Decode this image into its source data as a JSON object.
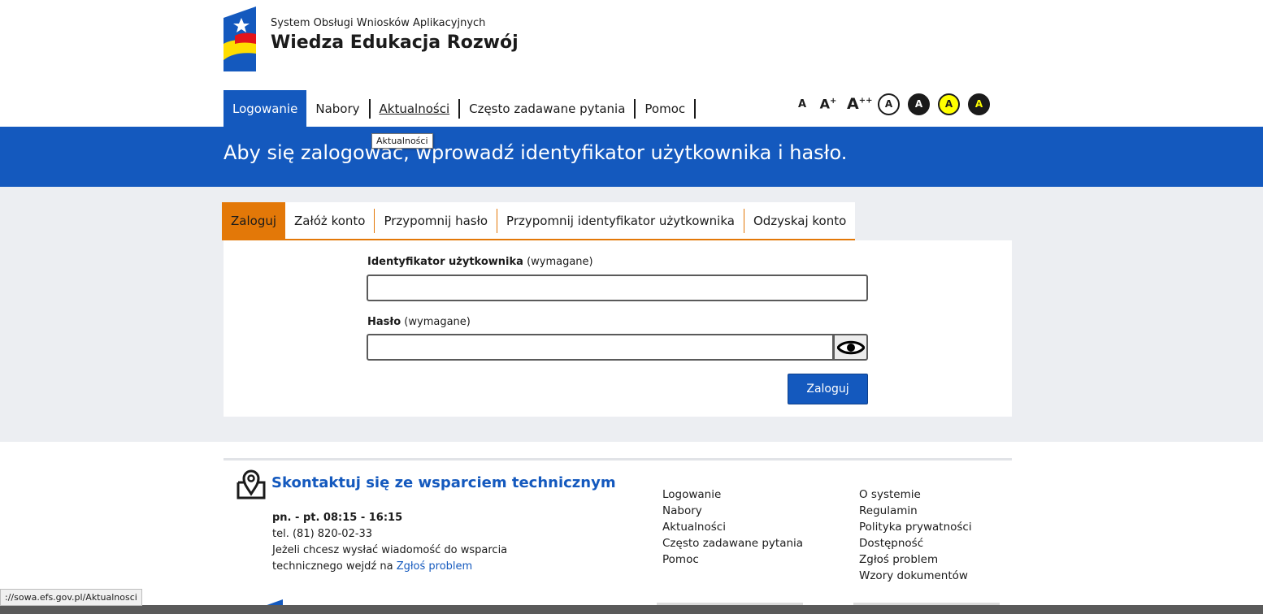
{
  "header": {
    "system_subtitle": "System Obsługi Wniosków Aplikacyjnych",
    "system_title": "Wiedza Edukacja Rozwój"
  },
  "nav": {
    "items": [
      {
        "label": "Logowanie",
        "active": true
      },
      {
        "label": "Nabory"
      },
      {
        "label": "Aktualności",
        "hovered": true
      },
      {
        "label": "Często zadawane pytania"
      },
      {
        "label": "Pomoc"
      }
    ]
  },
  "accessibility": {
    "font_small": "A",
    "font_medium": "A",
    "font_medium_sup": "+",
    "font_large": "A",
    "font_large_sup": "++",
    "contrast_default": "A",
    "contrast_black_white": "A",
    "contrast_yellow_black": "A",
    "contrast_black_yellow": "A"
  },
  "tooltip": "Aktualności",
  "banner": {
    "text": "Aby się zalogować, wprowadź identyfikator użytkownika i hasło."
  },
  "tabs": [
    {
      "label": "Zaloguj",
      "active": true
    },
    {
      "label": "Załóż konto"
    },
    {
      "label": "Przypomnij hasło"
    },
    {
      "label": "Przypomnij identyfikator użytkownika"
    },
    {
      "label": "Odzyskaj konto"
    }
  ],
  "form": {
    "user_id_label": "Identyfikator użytkownika",
    "user_id_required": "(wymagane)",
    "user_id_value": "",
    "password_label": "Hasło",
    "password_required": "(wymagane)",
    "password_value": "",
    "submit_label": "Zaloguj"
  },
  "footer": {
    "support_title": "Skontaktuj się ze wsparciem technicznym",
    "hours": "pn. - pt. 08:15 - 16:15",
    "phone": "tel. (81) 820-02-33",
    "message_line1": "Jeżeli chcesz wysłać wiadomość do wsparcia",
    "message_line2_prefix": "technicznego wejdź na",
    "message_link": "Zgłoś problem",
    "links_col1": [
      "Logowanie",
      "Nabory",
      "Aktualności",
      "Często zadawane pytania",
      "Pomoc"
    ],
    "links_col2": [
      "O systemie",
      "Regulamin",
      "Polityka prywatności",
      "Dostępność",
      "Zgłoś problem",
      "Wzory dokumentów"
    ]
  },
  "status_bar": "://sowa.efs.gov.pl/Aktualnosci",
  "colors": {
    "primary_blue": "#1459be",
    "accent_orange": "#e37808",
    "content_bg": "#eceef2"
  }
}
